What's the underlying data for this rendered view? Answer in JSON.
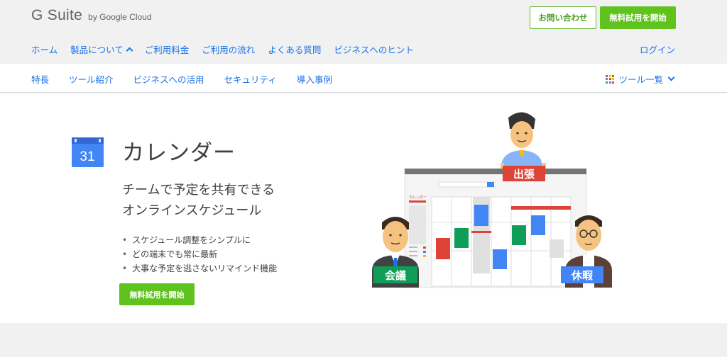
{
  "header": {
    "logo_main": "G Suite",
    "logo_sub": "by Google Cloud",
    "contact_label": "お問い合わせ",
    "trial_label": "無料試用を開始",
    "nav": [
      "ホーム",
      "製品について",
      "ご利用料金",
      "ご利用の流れ",
      "よくある質問",
      "ビジネスへのヒント"
    ],
    "login_label": "ログイン"
  },
  "subnav": {
    "items": [
      "特長",
      "ツール紹介",
      "ビジネスへの活用",
      "セキュリティ",
      "導入事例"
    ],
    "tools_label": "ツール一覧"
  },
  "hero": {
    "icon_text": "31",
    "title": "カレンダー",
    "tagline_1": "チームで予定を共有できる",
    "tagline_2": "オンラインスケジュール",
    "bullets": [
      "スケジュール調整をシンプルに",
      "どの端末でも常に最新",
      "大事な予定を逃さないリマインド機能"
    ],
    "cta_label": "無料試用を開始"
  },
  "illustration": {
    "calendar_label": "カレンダー",
    "sign_top": "出張",
    "sign_left": "会議",
    "sign_right": "休暇"
  },
  "colors": {
    "accent_blue": "#1a73e8",
    "cta_green": "#5fc21d",
    "event_red": "#db4437",
    "event_green": "#0f9d58",
    "event_blue": "#4285f4"
  }
}
